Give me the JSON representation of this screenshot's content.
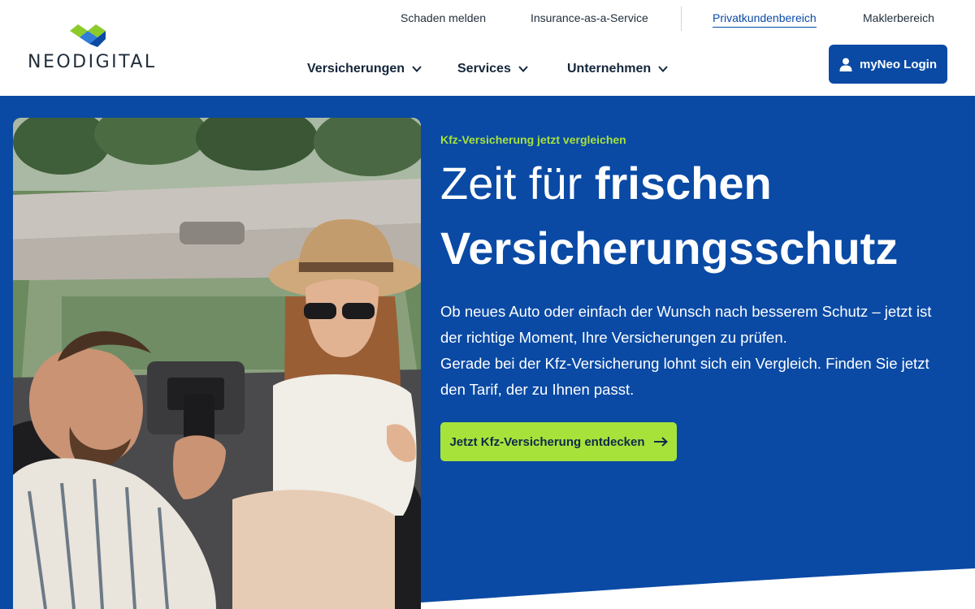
{
  "brand": {
    "name": "NEODIGITAL",
    "colors": {
      "primary": "#0a4aa5",
      "accent_green": "#a7e23a",
      "logo_blue": "#0a4aa5",
      "logo_green": "#8ccb2b",
      "text_dark": "#1f2d3a"
    }
  },
  "topnav": {
    "items": [
      {
        "label": "Schaden melden"
      },
      {
        "label": "Insurance-as-a-Service"
      },
      {
        "label": "Privatkundenbereich",
        "active": true
      },
      {
        "label": "Maklerbereich"
      }
    ]
  },
  "mainnav": {
    "items": [
      {
        "label": "Versicherungen",
        "icon": "chevron-down-icon"
      },
      {
        "label": "Services",
        "icon": "chevron-down-icon"
      },
      {
        "label": "Unternehmen",
        "icon": "chevron-down-icon"
      }
    ]
  },
  "login": {
    "label": "myNeo Login",
    "icon": "user-icon"
  },
  "hero": {
    "eyebrow": "Kfz-Versicherung jetzt vergleichen",
    "headline_light": "Zeit für",
    "headline_bold_1": "frischen",
    "headline_bold_2": "Versicherungsschutz",
    "paragraph_1": "Ob neues Auto oder einfach der Wunsch nach besserem Schutz – jetzt ist der richtige Moment, Ihre Versicherungen zu prüfen.",
    "paragraph_2": "Gerade bei der Kfz-Versicherung lohnt sich ein Vergleich. Finden Sie jetzt den Tarif, der zu Ihnen passt.",
    "cta_label": "Jetzt Kfz-Versicherung entdecken",
    "cta_icon": "arrow-right-icon"
  }
}
